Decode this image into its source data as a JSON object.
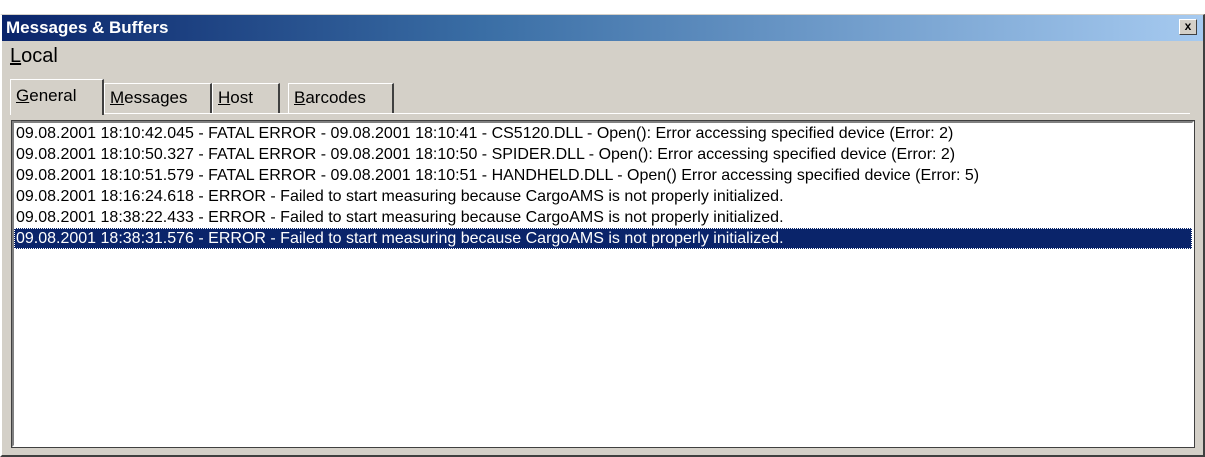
{
  "window": {
    "title": "Messages & Buffers",
    "close_label": "x"
  },
  "menu": {
    "items": [
      {
        "label_first": "L",
        "label_rest": "ocal"
      }
    ]
  },
  "tabs": [
    {
      "first": "G",
      "rest": "eneral",
      "active": true
    },
    {
      "first": "M",
      "rest": "essages",
      "active": false
    },
    {
      "first": "H",
      "rest": "ost",
      "active": false
    },
    {
      "first": "B",
      "rest": "arcodes",
      "active": false
    }
  ],
  "log": {
    "rows": [
      "09.08.2001 18:10:42.045 - FATAL ERROR - 09.08.2001 18:10:41 - CS5120.DLL - Open(): Error accessing specified device (Error: 2)",
      "09.08.2001 18:10:50.327 - FATAL ERROR - 09.08.2001 18:10:50 - SPIDER.DLL - Open(): Error accessing specified device (Error: 2)",
      "09.08.2001 18:10:51.579 - FATAL ERROR - 09.08.2001 18:10:51 - HANDHELD.DLL - Open() Error accessing specified device (Error: 5)",
      "09.08.2001 18:16:24.618 - ERROR - Failed to start measuring because CargoAMS is not properly initialized.",
      "09.08.2001 18:38:22.433 - ERROR - Failed to start measuring because CargoAMS is not properly initialized.",
      "09.08.2001 18:38:31.576 - ERROR - Failed to start measuring because CargoAMS is not properly initialized."
    ],
    "selected_index": 5
  }
}
